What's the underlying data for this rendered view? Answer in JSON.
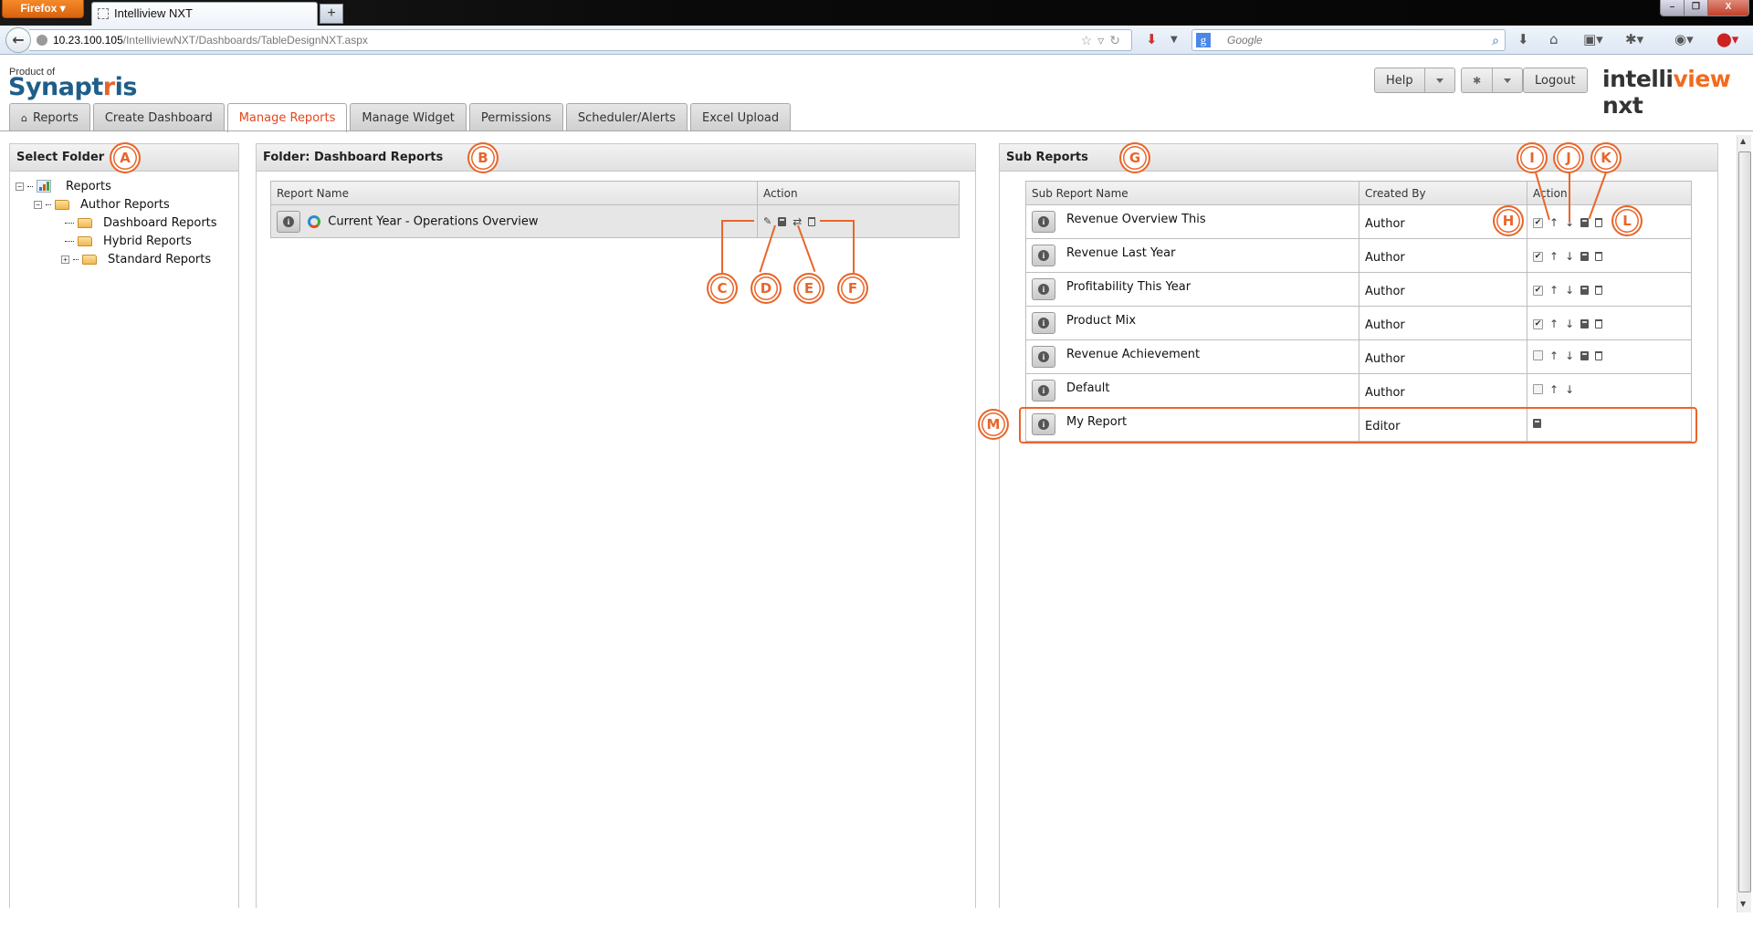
{
  "browser": {
    "menu_button": "Firefox ▾",
    "tab_title": "Intelliview NXT",
    "new_tab": "+",
    "url_host": "10.23.100.105",
    "url_path": "/IntelliviewNXT/Dashboards/TableDesignNXT.aspx",
    "search_placeholder": "Google",
    "window_controls": [
      "–",
      "❐",
      "X"
    ]
  },
  "app": {
    "product_of": "Product of",
    "brand_left_a": "Synapt",
    "brand_left_i": "r",
    "brand_left_b": "is",
    "brand_right_a": "intelli",
    "brand_right_b": "view",
    "brand_right_c": " nxt",
    "help_label": "Help",
    "logout_label": "Logout",
    "tabs": [
      {
        "label": "Reports",
        "icon": "home-icon"
      },
      {
        "label": "Create Dashboard"
      },
      {
        "label": "Manage Reports",
        "active": true
      },
      {
        "label": "Manage Widget"
      },
      {
        "label": "Permissions"
      },
      {
        "label": "Scheduler/Alerts"
      },
      {
        "label": "Excel Upload"
      }
    ]
  },
  "folder_panel": {
    "title": "Select Folder",
    "tree": [
      {
        "label": "Reports",
        "level": 0,
        "expander": "−",
        "icon": "chart-icon"
      },
      {
        "label": "Author Reports",
        "level": 1,
        "expander": "−",
        "icon": "folder-icon"
      },
      {
        "label": "Dashboard Reports",
        "level": 2,
        "icon": "folder-icon"
      },
      {
        "label": "Hybrid Reports",
        "level": 2,
        "icon": "folder-icon"
      },
      {
        "label": "Standard Reports",
        "level": 2,
        "expander": "+",
        "icon": "folder-icon"
      }
    ]
  },
  "reports_panel": {
    "title": "Folder: Dashboard Reports",
    "columns": [
      "Report Name",
      "Action"
    ],
    "rows": [
      {
        "name": "Current Year - Operations Overview",
        "actions": [
          "edit-icon",
          "save-icon",
          "move-icon",
          "delete-icon"
        ]
      }
    ]
  },
  "subreports_panel": {
    "title": "Sub Reports",
    "columns": [
      "Sub Report Name",
      "Created By",
      "Action"
    ],
    "rows": [
      {
        "name": "Revenue Overview This",
        "created_by": "Author",
        "checked": true,
        "up": true,
        "down": true,
        "save": true,
        "delete": true
      },
      {
        "name": "Revenue Last Year",
        "created_by": "Author",
        "checked": true,
        "up": true,
        "down": true,
        "save": true,
        "delete": true
      },
      {
        "name": "Profitability This Year",
        "created_by": "Author",
        "checked": true,
        "up": true,
        "down": true,
        "save": true,
        "delete": true
      },
      {
        "name": "Product Mix",
        "created_by": "Author",
        "checked": true,
        "up": true,
        "down": true,
        "save": true,
        "delete": true
      },
      {
        "name": "Revenue Achievement",
        "created_by": "Author",
        "checked": false,
        "up": true,
        "down": true,
        "save": true,
        "delete": true
      },
      {
        "name": "Default",
        "created_by": "Author",
        "checked": false,
        "up": true,
        "down": true,
        "save": false,
        "delete": false
      },
      {
        "name": "My Report",
        "created_by": "Editor",
        "checkbox": false,
        "up": false,
        "down": false,
        "save": true,
        "delete": false
      }
    ]
  },
  "callouts": [
    "A",
    "B",
    "C",
    "D",
    "E",
    "F",
    "G",
    "H",
    "I",
    "J",
    "K",
    "L",
    "M"
  ],
  "colors": {
    "accent": "#e8662a",
    "active_tab": "#e8451c",
    "brand_blue": "#1f5e8a"
  }
}
